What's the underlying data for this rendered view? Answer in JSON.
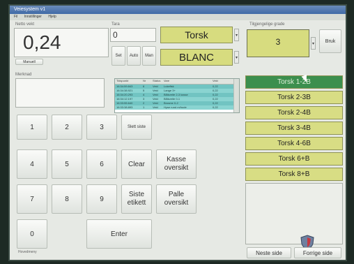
{
  "window": {
    "title": "Veiesystem v1",
    "menu": [
      "Fil",
      "Innstillinger",
      "Hjelp"
    ]
  },
  "weight": {
    "label": "Netto vekt",
    "value": "0,24",
    "sub_button": "Manuell"
  },
  "tara": {
    "label": "Tara",
    "value": "0",
    "buttons": [
      "Set",
      "Auto",
      "Man"
    ]
  },
  "product": {
    "species": "Torsk",
    "code": "BLANC"
  },
  "grades": {
    "label": "Tilgjengelige grade",
    "value": "3",
    "use_button": "Bruk"
  },
  "comment": {
    "label": "Merknad"
  },
  "log": {
    "columns": [
      "Tidspunkt",
      "Nr",
      "Status",
      "Vare",
      "Vekt"
    ],
    "rows": [
      [
        "16:34:59.843",
        "6",
        "Veid",
        "Lukefisk",
        "0,22"
      ],
      [
        "16:34:38.921",
        "5",
        "Veid",
        "Lange 3+",
        "0,22"
      ],
      [
        "16:34:20.293",
        "4",
        "Veid",
        "Blåkveite 2-3 kasse",
        "0,22"
      ],
      [
        "16:34:12.197",
        "3",
        "Veid",
        "Blåkveite 0-1",
        "0,22"
      ],
      [
        "16:33:55.640",
        "2",
        "Veid",
        "Brosme 0-2",
        "0,22"
      ],
      [
        "16:33:38.893",
        "1",
        "Veid",
        "Hyse rund m/hode",
        "0,22"
      ]
    ]
  },
  "keypad": {
    "keys": [
      "1",
      "2",
      "3",
      "4",
      "5",
      "6",
      "7",
      "8",
      "9",
      "0"
    ],
    "delete": "Slett siste",
    "clear": "Clear",
    "enter": "Enter",
    "kasse_line1": "Kasse",
    "kasse_line2": "oversikt",
    "siste_line1": "Siste",
    "siste_line2": "etikett",
    "palle_line1": "Palle",
    "palle_line2": "oversikt",
    "bottom_label": "Hovedmeny"
  },
  "side_list": {
    "items": [
      "Torsk 1-2B",
      "Torsk 2-3B",
      "Torsk 2-4B",
      "Torsk 3-4B",
      "Torsk 4-6B",
      "Torsk 6+B",
      "Torsk 8+B"
    ],
    "active_index": 0
  },
  "paging": {
    "next": "Neste side",
    "prev": "Forrige side"
  },
  "colors": {
    "accent_yellow": "#d7dc7f",
    "active_green": "#3c8f4e",
    "list_teal": "#71c4c2"
  }
}
